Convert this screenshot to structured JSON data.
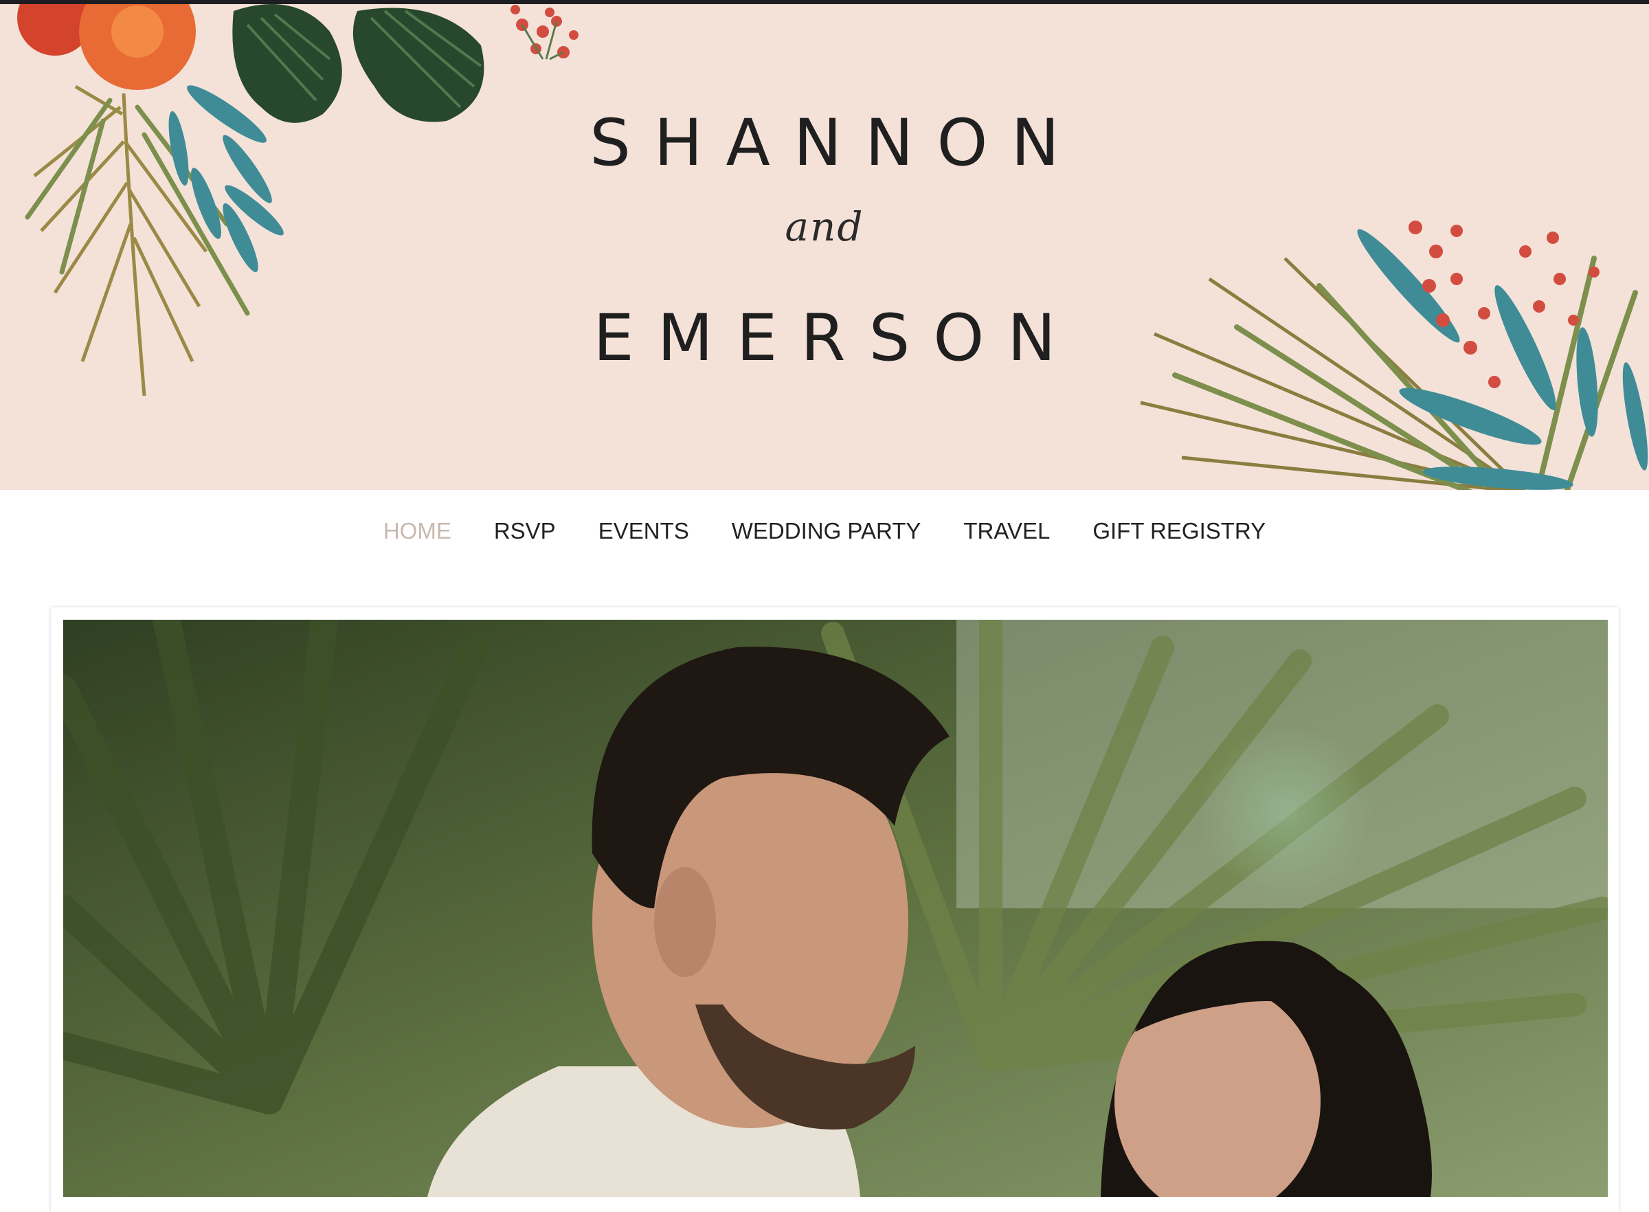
{
  "hero": {
    "name_first": "SHANNON",
    "connector": "and",
    "name_second": "EMERSON",
    "background": "#f4e2d9"
  },
  "nav": {
    "items": [
      {
        "label": "HOME",
        "active": true
      },
      {
        "label": "RSVP"
      },
      {
        "label": "EVENTS"
      },
      {
        "label": "WEDDING PARTY"
      },
      {
        "label": "TRAVEL"
      },
      {
        "label": "GIFT REGISTRY"
      }
    ],
    "active_color": "#c9b8ae",
    "text_color": "#222222"
  },
  "photo": {
    "description": "couple-portrait-photo"
  },
  "decorations": {
    "left": "tropical-leaves-and-hibiscus",
    "right": "tropical-leaves-and-red-flowers"
  }
}
